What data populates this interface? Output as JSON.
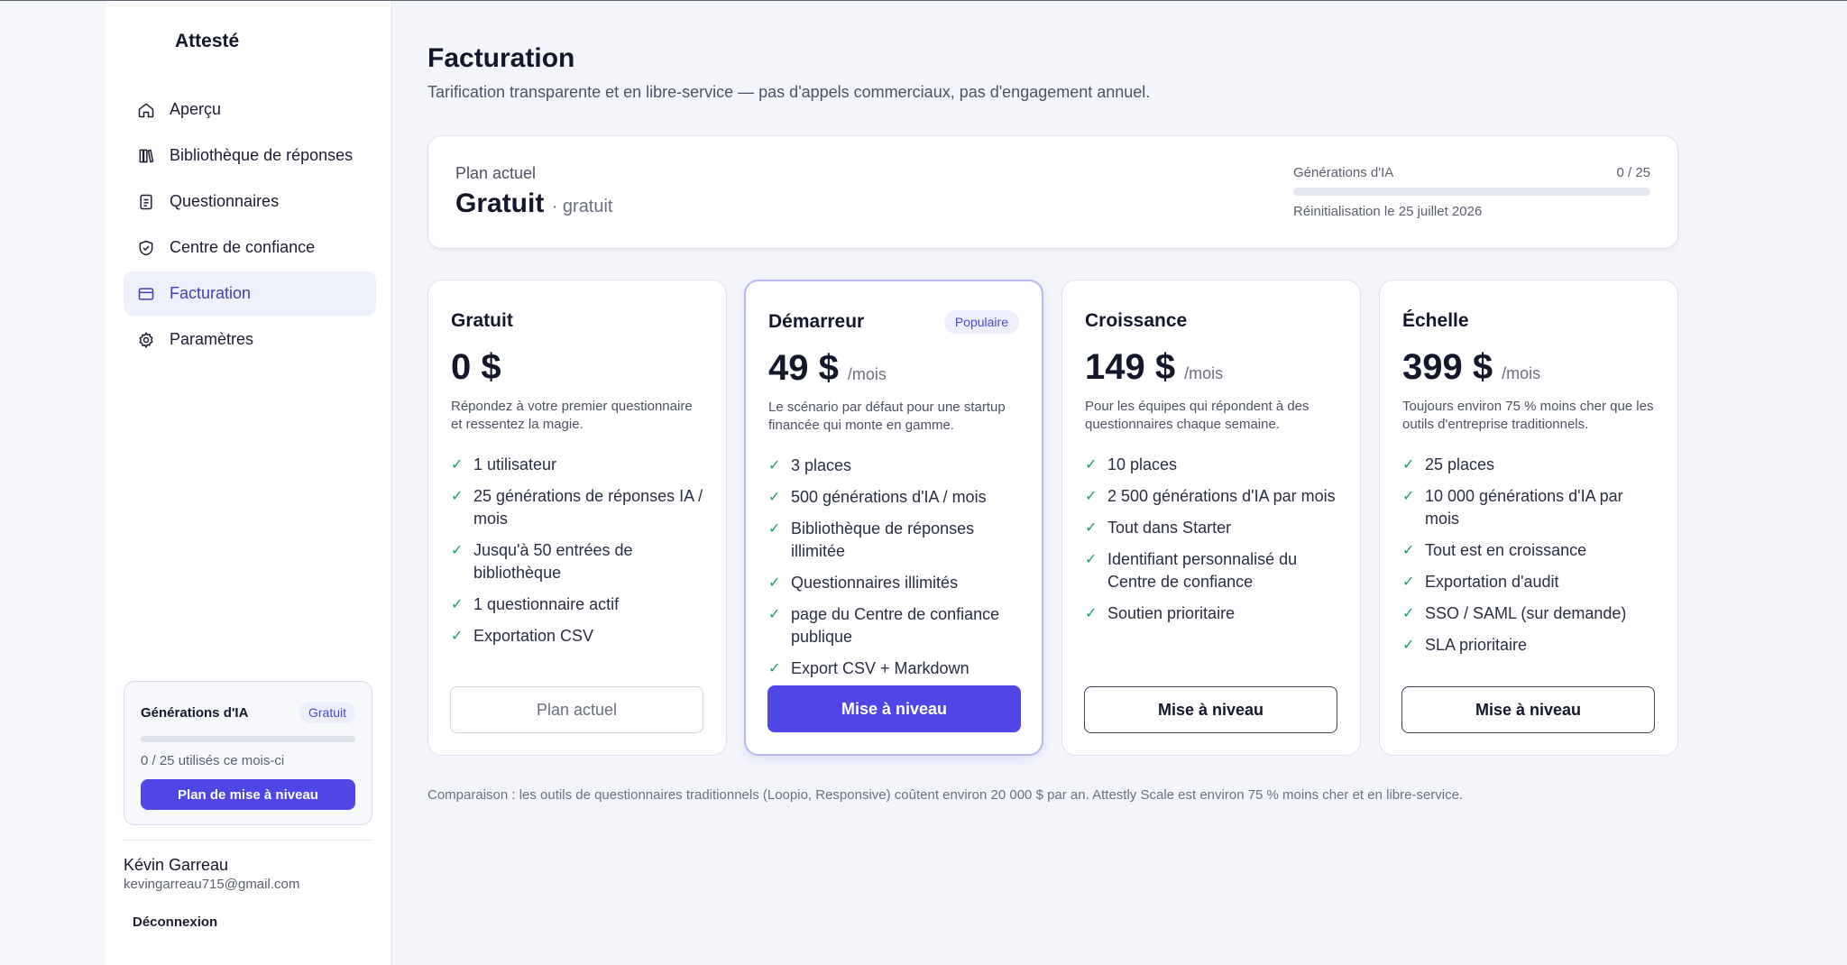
{
  "brand": "Attesté",
  "sidebar": {
    "items": [
      {
        "label": "Aperçu",
        "icon": "home-icon"
      },
      {
        "label": "Bibliothèque de réponses",
        "icon": "library-icon"
      },
      {
        "label": "Questionnaires",
        "icon": "clipboard-icon"
      },
      {
        "label": "Centre de confiance",
        "icon": "shield-check-icon"
      },
      {
        "label": "Facturation",
        "icon": "credit-card-icon",
        "active": true
      },
      {
        "label": "Paramètres",
        "icon": "gear-icon"
      }
    ],
    "usage": {
      "title": "Générations d'IA",
      "badge": "Gratuit",
      "progress_fraction": 0,
      "text": "0 / 25 utilisés ce mois-ci",
      "button": "Plan de mise à niveau"
    },
    "user": {
      "name": "Kévin Garreau",
      "email": "kevingarreau715@gmail.com"
    },
    "logout": "Déconnexion"
  },
  "page": {
    "title": "Facturation",
    "subtitle": "Tarification transparente et en libre-service — pas d'appels commerciaux, pas d'engagement annuel."
  },
  "current_plan": {
    "label": "Plan actuel",
    "name": "Gratuit",
    "sub": "· gratuit",
    "usage_label": "Générations d'IA",
    "usage_count": "0 / 25",
    "progress_fraction": 0,
    "reset": "Réinitialisation le 25 juillet 2026"
  },
  "plans": [
    {
      "name": "Gratuit",
      "badge": "",
      "price": "0 $",
      "per": "",
      "desc": "Répondez à votre premier questionnaire et ressentez la magie.",
      "features": [
        "1 utilisateur",
        "25 générations de réponses IA / mois",
        "Jusqu'à 50 entrées de bibliothèque",
        "1 questionnaire actif",
        "Exportation CSV"
      ],
      "button": "Plan actuel"
    },
    {
      "name": "Démarreur",
      "badge": "Populaire",
      "price": "49 $",
      "per": "/mois",
      "desc": "Le scénario par défaut pour une startup financée qui monte en gamme.",
      "features": [
        "3 places",
        "500 générations d'IA / mois",
        "Bibliothèque de réponses illimitée",
        "Questionnaires illimités",
        "page du Centre de confiance publique",
        "Export CSV + Markdown"
      ],
      "button": "Mise à niveau"
    },
    {
      "name": "Croissance",
      "badge": "",
      "price": "149 $",
      "per": "/mois",
      "desc": "Pour les équipes qui répondent à des questionnaires chaque semaine.",
      "features": [
        "10 places",
        "2 500 générations d'IA par mois",
        "Tout dans Starter",
        "Identifiant personnalisé du Centre de confiance",
        "Soutien prioritaire"
      ],
      "button": "Mise à niveau"
    },
    {
      "name": "Échelle",
      "badge": "",
      "price": "399 $",
      "per": "/mois",
      "desc": "Toujours environ 75 % moins cher que les outils d'entreprise traditionnels.",
      "features": [
        "25 places",
        "10 000 générations d'IA par mois",
        "Tout est en croissance",
        "Exportation d'audit",
        "SSO / SAML (sur demande)",
        "SLA prioritaire"
      ],
      "button": "Mise à niveau"
    }
  ],
  "comparison": "Comparaison : les outils de questionnaires traditionnels (Loopio, Responsive) coûtent environ 20 000 $ par an. Attestly Scale est environ 75 % moins cher et en libre-service.",
  "colors": {
    "accent": "#4f46e5",
    "check": "#1f9d6b",
    "active_bg": "#eef0fc"
  }
}
